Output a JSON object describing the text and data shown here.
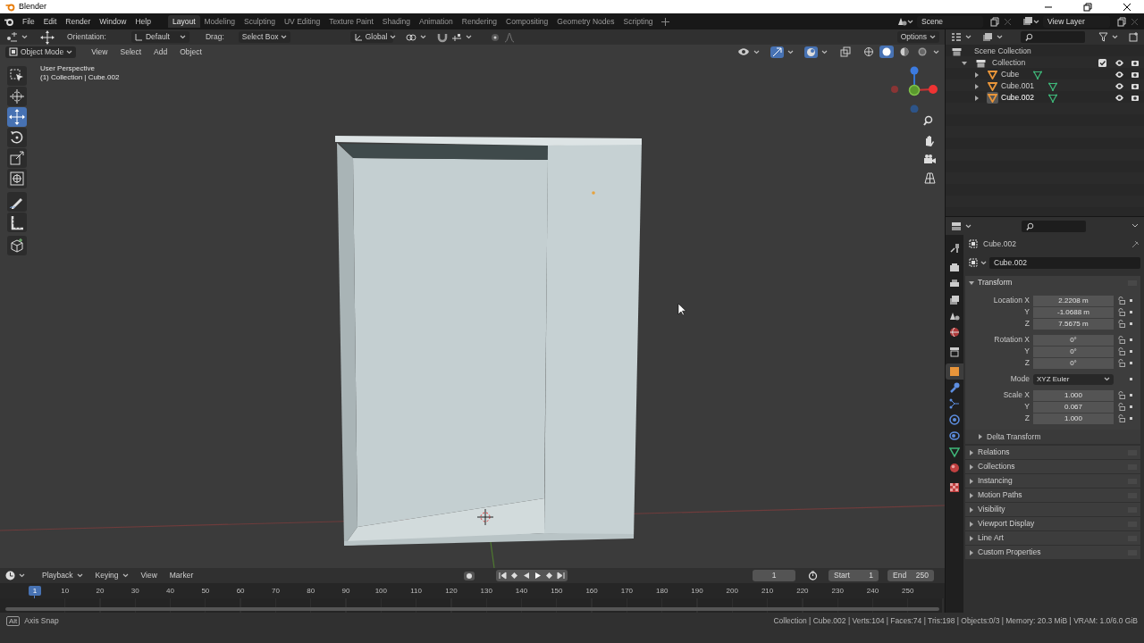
{
  "window": {
    "title": "Blender"
  },
  "menus": [
    "File",
    "Edit",
    "Render",
    "Window",
    "Help"
  ],
  "workspaces": [
    {
      "label": "Layout",
      "selected": true
    },
    {
      "label": "Modeling",
      "selected": false
    },
    {
      "label": "Sculpting",
      "selected": false
    },
    {
      "label": "UV Editing",
      "selected": false
    },
    {
      "label": "Texture Paint",
      "selected": false
    },
    {
      "label": "Shading",
      "selected": false
    },
    {
      "label": "Animation",
      "selected": false
    },
    {
      "label": "Rendering",
      "selected": false
    },
    {
      "label": "Compositing",
      "selected": false
    },
    {
      "label": "Geometry Nodes",
      "selected": false
    },
    {
      "label": "Scripting",
      "selected": false
    }
  ],
  "scene": "Scene",
  "view_layer": "View Layer",
  "tool_header": {
    "orientation_label": "Orientation:",
    "orientation": "Default",
    "drag_label": "Drag:",
    "drag": "Select Box",
    "transform_orientation": "Global",
    "options": "Options"
  },
  "viewport_header": {
    "mode": "Object Mode",
    "menus": [
      "View",
      "Select",
      "Add",
      "Object"
    ],
    "show_gizmo": true,
    "show_overlays": true,
    "shading": [
      {
        "kind": "wireframe",
        "selected": false
      },
      {
        "kind": "solid",
        "selected": true
      },
      {
        "kind": "material",
        "selected": false
      },
      {
        "kind": "rendered",
        "selected": false
      }
    ]
  },
  "toolbar": [
    [
      {
        "kind": "select",
        "selected": false
      },
      {
        "kind": "cursor",
        "selected": false
      },
      {
        "kind": "move",
        "selected": true
      },
      {
        "kind": "rotate",
        "selected": false
      },
      {
        "kind": "scale",
        "selected": false
      },
      {
        "kind": "transform",
        "selected": false
      }
    ],
    [
      {
        "kind": "annotate",
        "selected": false
      },
      {
        "kind": "measure",
        "selected": false
      }
    ],
    [
      {
        "kind": "add_cube",
        "selected": false
      }
    ]
  ],
  "viewport": {
    "view_name": "User Perspective",
    "context": "(1) Collection | Cube.002"
  },
  "outliner": {
    "root": "Scene Collection",
    "collections": [
      {
        "label": "Collection",
        "checked": true,
        "expanded": true,
        "children": [
          {
            "label": "Cube",
            "selected": false
          },
          {
            "label": "Cube.001",
            "selected": false
          },
          {
            "label": "Cube.002",
            "selected": true
          }
        ]
      }
    ]
  },
  "properties": {
    "tab_groups": [
      [
        {
          "kind": "tool",
          "selected": false
        }
      ],
      [
        {
          "kind": "render",
          "selected": false
        },
        {
          "kind": "output",
          "selected": false
        },
        {
          "kind": "view_layer",
          "selected": false
        },
        {
          "kind": "scene",
          "selected": false
        },
        {
          "kind": "world",
          "selected": false
        }
      ],
      [
        {
          "kind": "collection",
          "selected": false
        }
      ],
      [
        {
          "kind": "object",
          "selected": true
        },
        {
          "kind": "modifiers",
          "selected": false
        },
        {
          "kind": "particles",
          "selected": false
        },
        {
          "kind": "physics",
          "selected": false
        },
        {
          "kind": "constraints",
          "selected": false
        },
        {
          "kind": "data",
          "selected": false
        },
        {
          "kind": "material",
          "selected": false
        }
      ],
      [
        {
          "kind": "texture",
          "selected": false
        }
      ]
    ],
    "context": "Cube.002",
    "name": "Cube.002",
    "transform": {
      "title": "Transform",
      "expanded": true,
      "groups": [
        [
          {
            "label": "Location X",
            "value": "2.2208 m",
            "kind": "number"
          },
          {
            "label": "Y",
            "value": "-1.0688 m",
            "kind": "number"
          },
          {
            "label": "Z",
            "value": "7.5675 m",
            "kind": "number"
          }
        ],
        [
          {
            "label": "Rotation X",
            "value": "0°",
            "kind": "number"
          },
          {
            "label": "Y",
            "value": "0°",
            "kind": "number"
          },
          {
            "label": "Z",
            "value": "0°",
            "kind": "number"
          }
        ],
        [
          {
            "label": "Mode",
            "value": "XYZ Euler",
            "kind": "dropdown"
          }
        ],
        [
          {
            "label": "Scale X",
            "value": "1.000",
            "kind": "number"
          },
          {
            "label": "Y",
            "value": "0.067",
            "kind": "number"
          },
          {
            "label": "Z",
            "value": "1.000",
            "kind": "number"
          }
        ]
      ],
      "subpanels": [
        {
          "title": "Delta Transform",
          "expanded": false
        }
      ]
    },
    "panels": [
      {
        "title": "Relations",
        "expanded": false
      },
      {
        "title": "Collections",
        "expanded": false
      },
      {
        "title": "Instancing",
        "expanded": false
      },
      {
        "title": "Motion Paths",
        "expanded": false
      },
      {
        "title": "Visibility",
        "expanded": false
      },
      {
        "title": "Viewport Display",
        "expanded": false
      },
      {
        "title": "Line Art",
        "expanded": false
      },
      {
        "title": "Custom Properties",
        "expanded": false
      }
    ]
  },
  "timeline": {
    "menus": [
      {
        "label": "Playback",
        "dropdown": true
      },
      {
        "label": "Keying",
        "dropdown": true
      },
      {
        "label": "View",
        "dropdown": false
      },
      {
        "label": "Marker",
        "dropdown": false
      }
    ],
    "playhead": "1",
    "ticks": [
      "10",
      "20",
      "30",
      "40",
      "50",
      "60",
      "70",
      "80",
      "90",
      "100",
      "110",
      "120",
      "130",
      "140",
      "150",
      "160",
      "170",
      "180",
      "190",
      "200",
      "210",
      "220",
      "230",
      "240",
      "250"
    ],
    "current_frame": "1",
    "start_label": "Start",
    "start": "1",
    "end_label": "End",
    "end": "250"
  },
  "status_bar": {
    "key": "Alt",
    "hint": "Axis Snap",
    "stats": "Collection | Cube.002 | Verts:104 | Faces:74 | Tris:198 | Objects:0/3 | Memory: 20.3 MiB | VRAM: 1.0/6.0 GiB"
  }
}
